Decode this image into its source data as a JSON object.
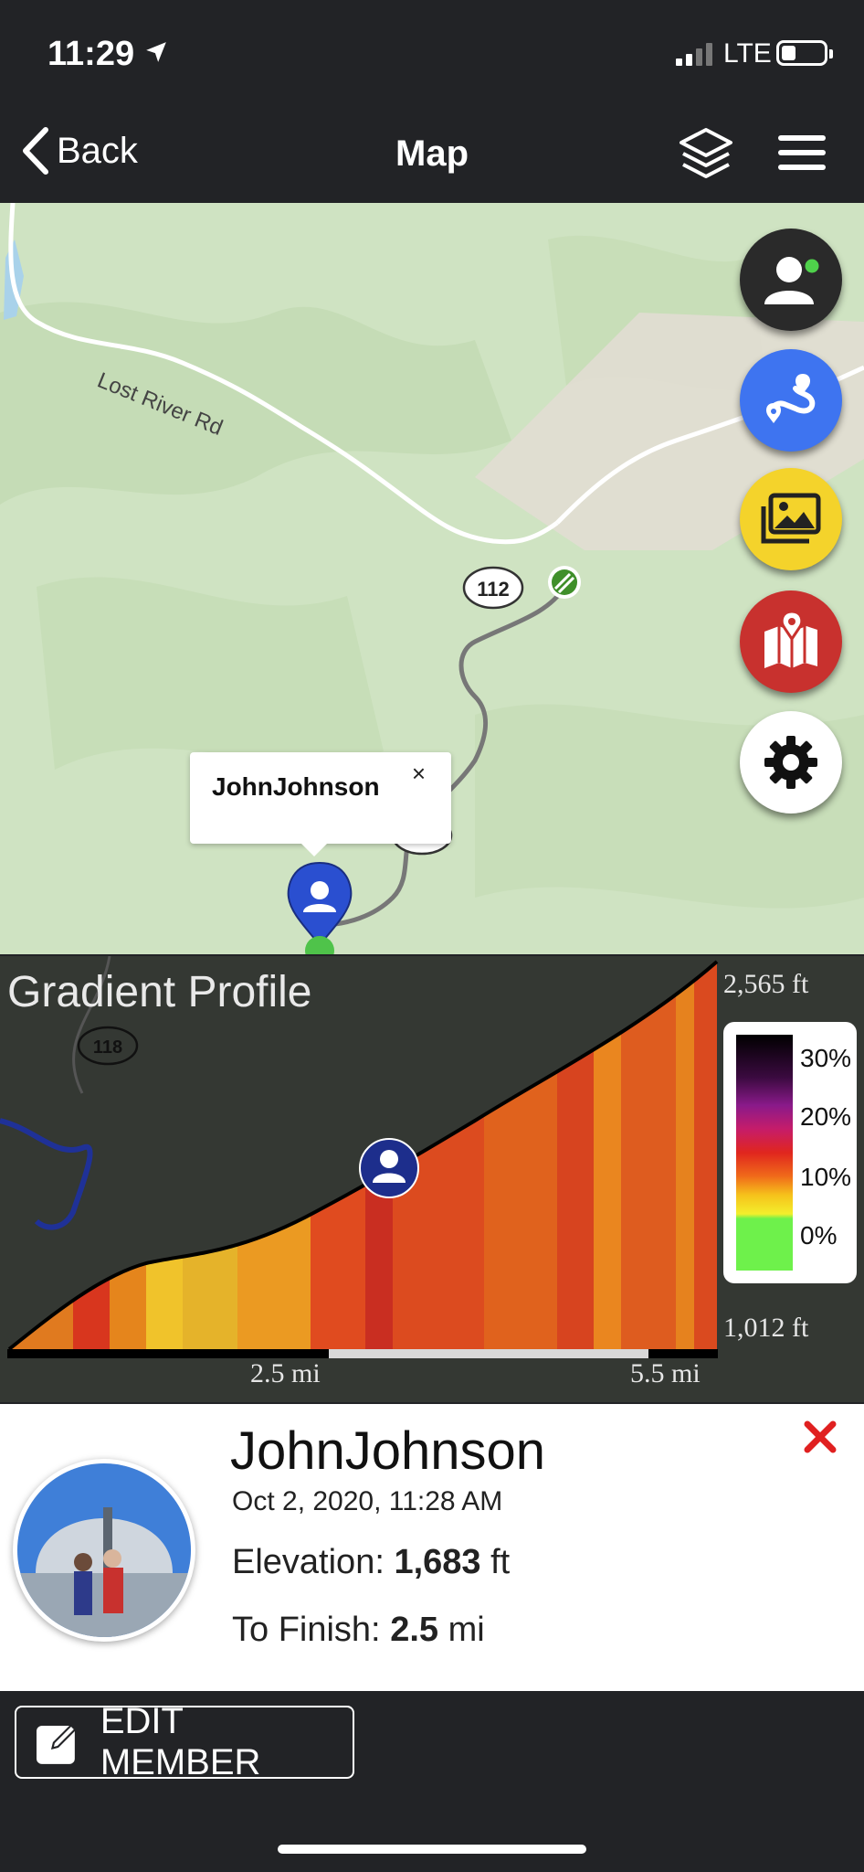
{
  "status": {
    "time": "11:29",
    "network": "LTE",
    "battery_percent": 35
  },
  "nav": {
    "back_label": "Back",
    "title": "Map"
  },
  "map": {
    "road_name": "Lost River Rd",
    "route_shield_1": "112",
    "route_shield_2": "118",
    "popup_name": "JohnJohnson",
    "popup_close": "×"
  },
  "fabs": [
    {
      "name": "members-button",
      "color": "#2a2a2a"
    },
    {
      "name": "route-button",
      "color": "#3e74f0"
    },
    {
      "name": "photos-button",
      "color": "#f4d32b"
    },
    {
      "name": "maps-button",
      "color": "#c8312e"
    },
    {
      "name": "settings-button",
      "color": "#ffffff"
    }
  ],
  "gradient_profile": {
    "title": "Gradient Profile",
    "elevation_max": "2,565 ft",
    "elevation_min": "1,012 ft",
    "x_labels": [
      "2.5 mi",
      "5.5 mi"
    ],
    "legend": [
      "30%",
      "20%",
      "10%",
      "0%"
    ]
  },
  "member": {
    "name": "JohnJohnson",
    "timestamp": "Oct 2, 2020, 11:28 AM",
    "elevation_label": "Elevation:",
    "elevation_value": "1,683",
    "elevation_unit": "ft",
    "finish_label": "To Finish:",
    "finish_value": "2.5",
    "finish_unit": "mi"
  },
  "actions": {
    "edit_label": "EDIT MEMBER"
  }
}
